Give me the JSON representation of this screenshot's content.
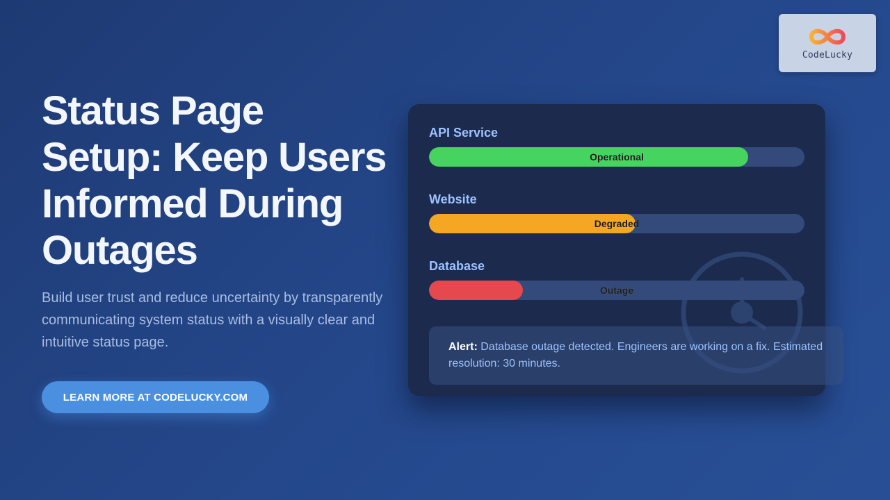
{
  "logo": {
    "name": "CodeLucky"
  },
  "hero": {
    "title": "Status Page Setup: Keep Users Informed During Outages",
    "subtitle": "Build user trust and reduce uncertainty by transparently communicating system status with a visually clear and intuitive status page.",
    "cta_label": "LEARN MORE AT CODELUCKY.COM"
  },
  "status_card": {
    "services": [
      {
        "name": "API Service",
        "status": "Operational",
        "level": 0.85,
        "color": "#46d35f"
      },
      {
        "name": "Website",
        "status": "Degraded",
        "level": 0.55,
        "color": "#f5a623"
      },
      {
        "name": "Database",
        "status": "Outage",
        "level": 0.25,
        "color": "#e5484d"
      }
    ],
    "alert": {
      "title": "Alert:",
      "message": "Database outage detected. Engineers are working on a fix. Estimated resolution: 30 minutes."
    }
  },
  "icons": {
    "logo": "infinity-icon",
    "watermark": "stopwatch-icon"
  },
  "colors": {
    "accent": "#4a8fe0",
    "card_bg": "#1c2a4d",
    "track_bg": "#334a7a",
    "label": "#9cc2ff"
  }
}
